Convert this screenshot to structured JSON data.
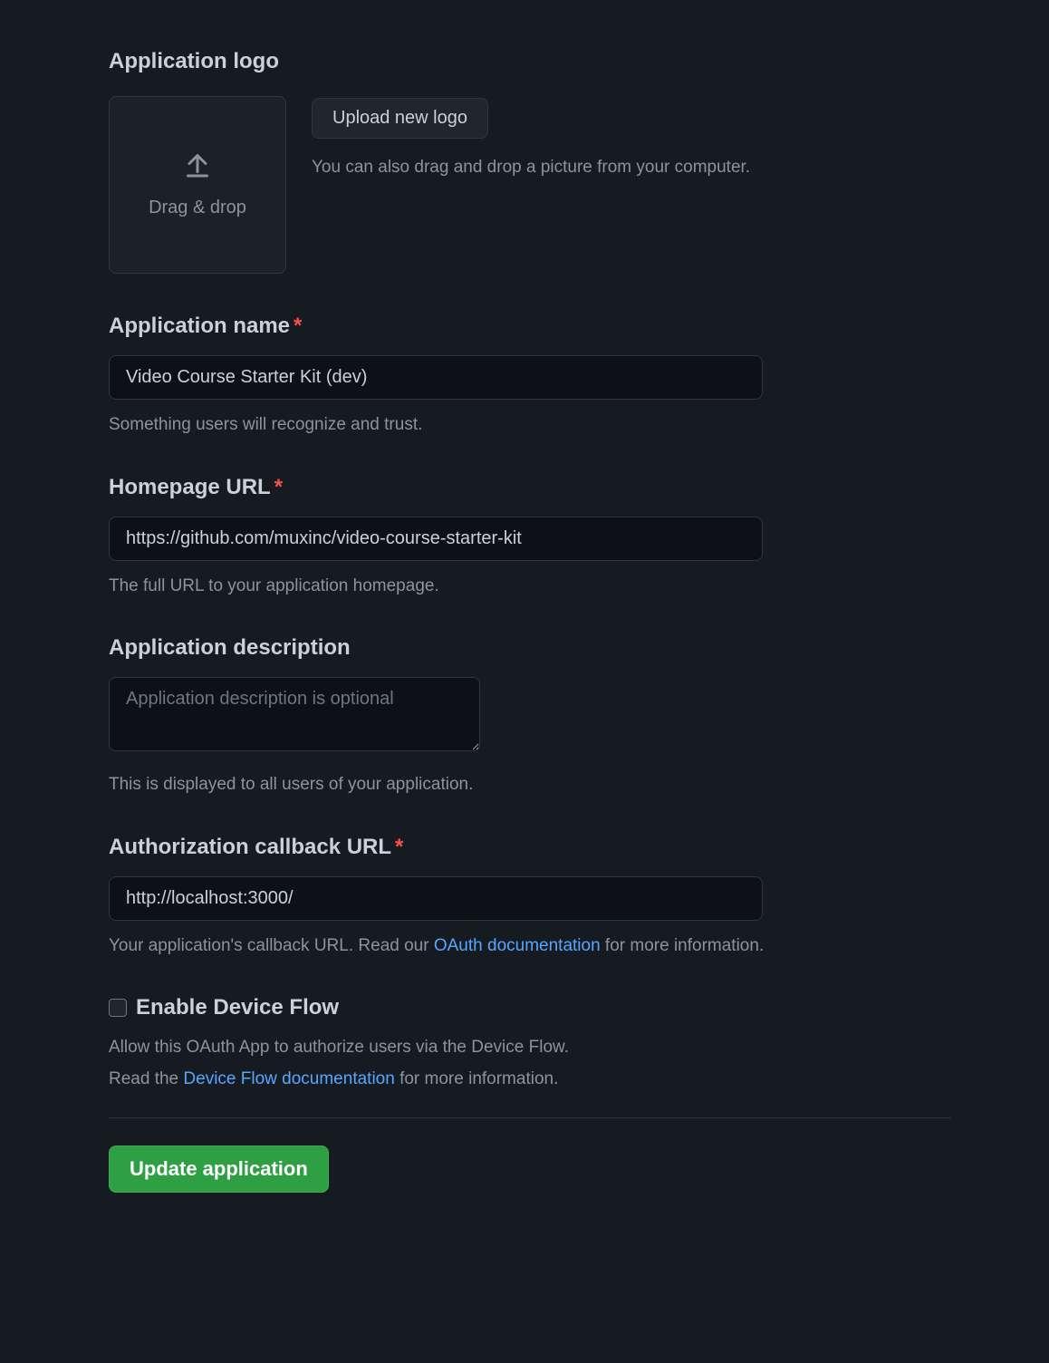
{
  "logo": {
    "heading": "Application logo",
    "dropzone_label": "Drag & drop",
    "upload_button": "Upload new logo",
    "help": "You can also drag and drop a picture from your computer."
  },
  "app_name": {
    "label": "Application name",
    "required": "*",
    "value": "Video Course Starter Kit (dev)",
    "help": "Something users will recognize and trust."
  },
  "homepage": {
    "label": "Homepage URL",
    "required": "*",
    "value": "https://github.com/muxinc/video-course-starter-kit",
    "help": "The full URL to your application homepage."
  },
  "description": {
    "label": "Application description",
    "placeholder": "Application description is optional",
    "value": "",
    "help": "This is displayed to all users of your application."
  },
  "callback": {
    "label": "Authorization callback URL",
    "required": "*",
    "value": "http://localhost:3000/",
    "help_before": "Your application's callback URL. Read our ",
    "link_text": "OAuth documentation",
    "help_after": " for more information."
  },
  "device_flow": {
    "label": "Enable Device Flow",
    "help1": "Allow this OAuth App to authorize users via the Device Flow.",
    "help2_before": "Read the ",
    "help2_link": "Device Flow documentation",
    "help2_after": " for more information."
  },
  "submit": {
    "label": "Update application"
  }
}
